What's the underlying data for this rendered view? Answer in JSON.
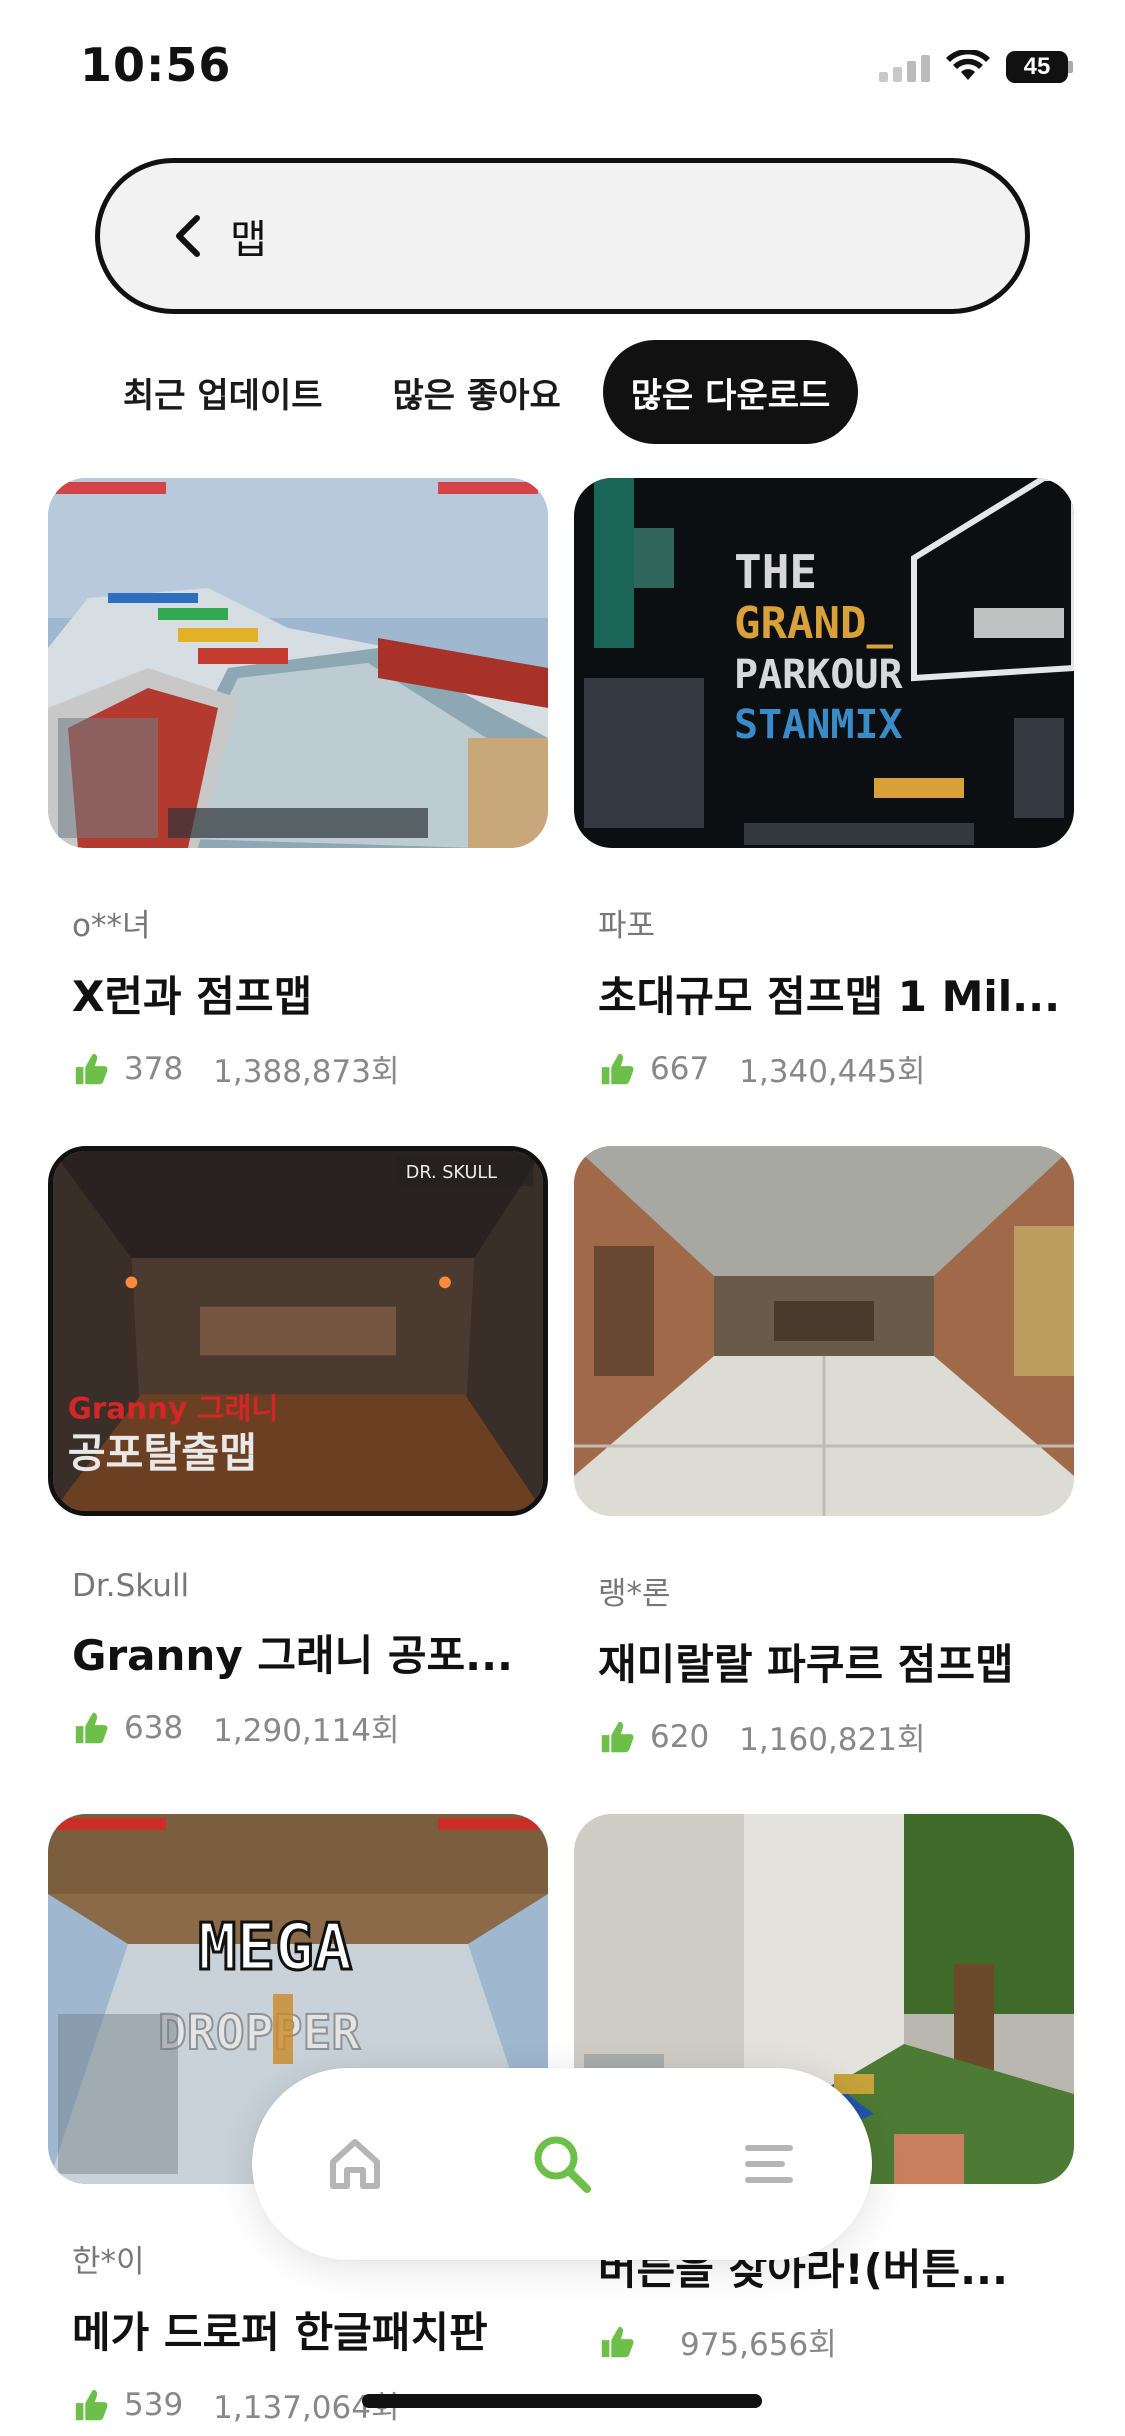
{
  "status_bar": {
    "time": "10:56",
    "battery": "45"
  },
  "search": {
    "query": "맵"
  },
  "tabs": [
    {
      "label": "최근 업데이트",
      "active": false
    },
    {
      "label": "많은 좋아요",
      "active": false
    },
    {
      "label": "많은 다운로드",
      "active": true
    }
  ],
  "maps": [
    {
      "creator": "o**녀",
      "title": "X런과 점프맵",
      "likes": "378",
      "downloads": "1,388,873회"
    },
    {
      "creator": "파포",
      "title": "초대규모 점프맵 1 Mil...",
      "likes": "667",
      "downloads": "1,340,445회"
    },
    {
      "creator": "Dr.Skull",
      "title": "Granny 그래니 공포...",
      "likes": "638",
      "downloads": "1,290,114회"
    },
    {
      "creator": "랭*론",
      "title": "재미랄랄 파쿠르 점프맵",
      "likes": "620",
      "downloads": "1,160,821회"
    },
    {
      "creator": "한*이",
      "title": "메가 드로퍼 한글패치판",
      "likes": "539",
      "downloads": "1,137,064회"
    },
    {
      "creator": "",
      "title": "버튼을 찾아라!(버튼...",
      "likes": "",
      "downloads": "975,656회"
    }
  ],
  "thumb_text": {
    "parkour_line1": "THE",
    "parkour_line2": "GRAND_",
    "parkour_line3": "PARKOUR",
    "parkour_line4": "STANMIX",
    "skull_badge": "DR. SKULL",
    "granny_line1": "Granny 그래니",
    "granny_line2": "공포탈출맵",
    "mega_line1": "MEGA",
    "mega_line2": "DROPPER"
  },
  "colors": {
    "accent_green": "#6cc04a",
    "tab_active_bg": "#111111"
  },
  "nav": [
    {
      "icon": "home-icon",
      "active": false
    },
    {
      "icon": "search-icon",
      "active": true
    },
    {
      "icon": "menu-icon",
      "active": false
    }
  ]
}
